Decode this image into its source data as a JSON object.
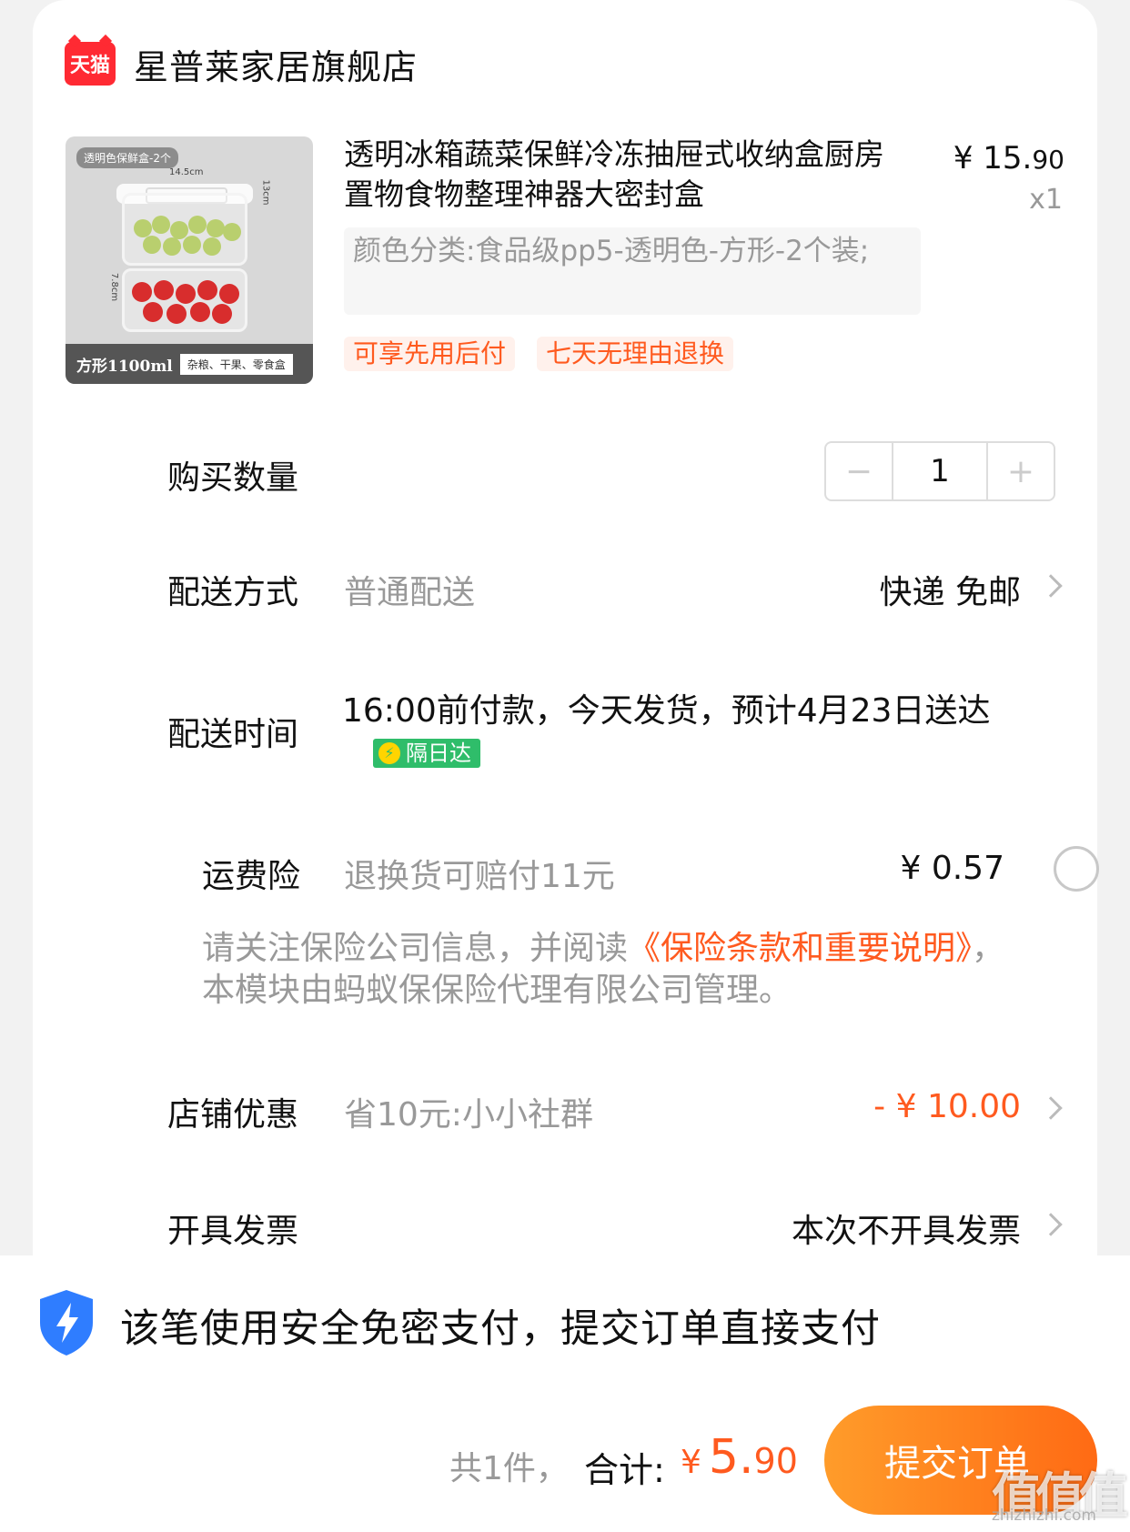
{
  "shop": {
    "logo_text": "天猫",
    "name": "星普莱家居旗舰店"
  },
  "product": {
    "image": {
      "tag": "透明色保鲜盒-2个",
      "footer_main": "方形1100ml",
      "footer_sub": "杂粮、干果、零食盒",
      "dim_width": "14.5cm",
      "dim_height_top": "13cm",
      "dim_height_bottom": "7.8cm"
    },
    "title": "透明冰箱蔬菜保鲜冷冻抽屉式收纳盒厨房置物食物整理神器大密封盒",
    "price_symbol": "¥",
    "price_int": "15.",
    "price_dec": "90",
    "quantity_label": "x1",
    "sku": "颜色分类:食品级pp5-透明色-方形-2个装;",
    "tags": [
      "可享先用后付",
      "七天无理由退换"
    ]
  },
  "quantity": {
    "label": "购买数量",
    "minus": "−",
    "value": "1",
    "plus": "+"
  },
  "delivery": {
    "label": "配送方式",
    "method": "普通配送",
    "value": "快递 免邮"
  },
  "delivery_time": {
    "label": "配送时间",
    "text": "16:00前付款，今天发货，预计4月23日送达",
    "badge": "隔日达"
  },
  "shipping_insurance": {
    "label": "运费险",
    "desc": "退换货可赔付11元",
    "price": "¥ 0.57"
  },
  "insurance_notice": {
    "prefix": "请关注保险公司信息，并阅读",
    "link": "《保险条款和重要说明》",
    "suffix": "，本模块由蚂蚁保保险代理有限公司管理。"
  },
  "shop_discount": {
    "label": "店铺优惠",
    "desc": "省10元:小小社群",
    "value": "- ¥ 10.00"
  },
  "invoice": {
    "label": "开具发票",
    "value": "本次不开具发票"
  },
  "bottom": {
    "secure_text": "该笔使用安全免密支付，提交订单直接支付",
    "count_text": "共1件，",
    "total_label": "合计:",
    "total_currency": "¥",
    "total_int": "5.",
    "total_dec": "90",
    "submit_label": "提交订单"
  },
  "watermark": {
    "main": "值值值",
    "sub": "zhizhizhi.com"
  },
  "colors": {
    "accent": "#ff5a1f",
    "tmall_red": "#ff2a33",
    "next_day_green": "#2fbd6a",
    "shield_blue": "#2f7dff"
  }
}
